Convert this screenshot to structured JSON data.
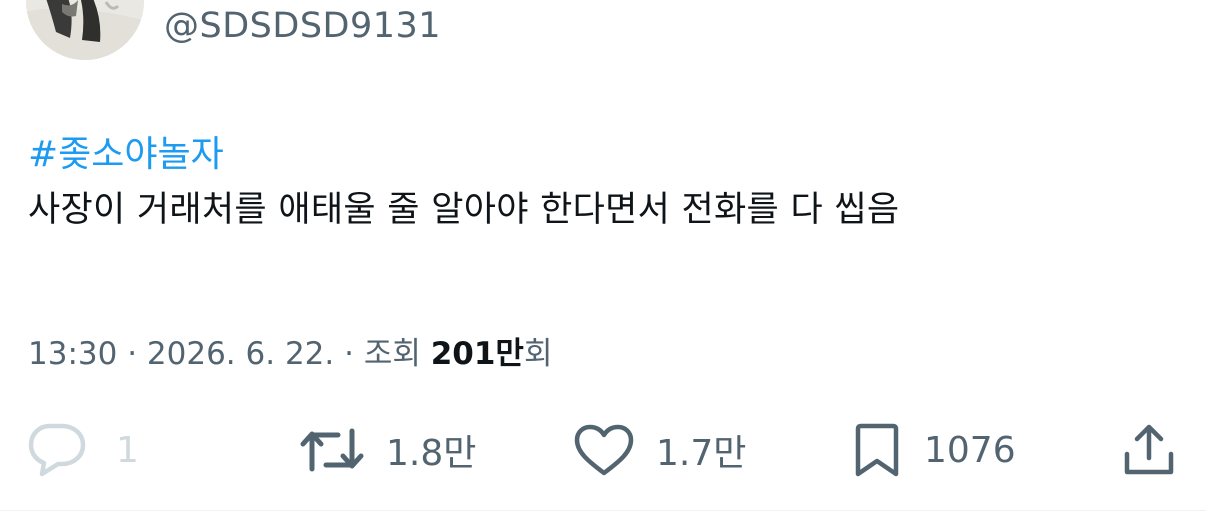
{
  "author": {
    "handle": "@SDSDSD9131"
  },
  "tweet": {
    "hashtag": "#좆소야놀자",
    "text": "사장이 거래처를 애태울 줄 알아야 한다면서 전화를 다 씹음"
  },
  "meta": {
    "time": "13:30",
    "separator1": " · ",
    "date": "2026. 6. 22.",
    "separator2": " · ",
    "views_label": "조회 ",
    "views_number": "201만",
    "views_suffix": "회"
  },
  "actions": {
    "reply_count": "1",
    "retweet_count": "1.8만",
    "like_count": "1.7만",
    "bookmark_count": "1076",
    "icons": {
      "reply": "reply-icon",
      "retweet": "retweet-icon",
      "like": "heart-icon",
      "bookmark": "bookmark-icon",
      "share": "share-icon"
    }
  },
  "colors": {
    "hashtag": "#1d9bf0",
    "text": "#0f1419",
    "secondary": "#536471",
    "reply_disabled": "#cfd9de"
  }
}
